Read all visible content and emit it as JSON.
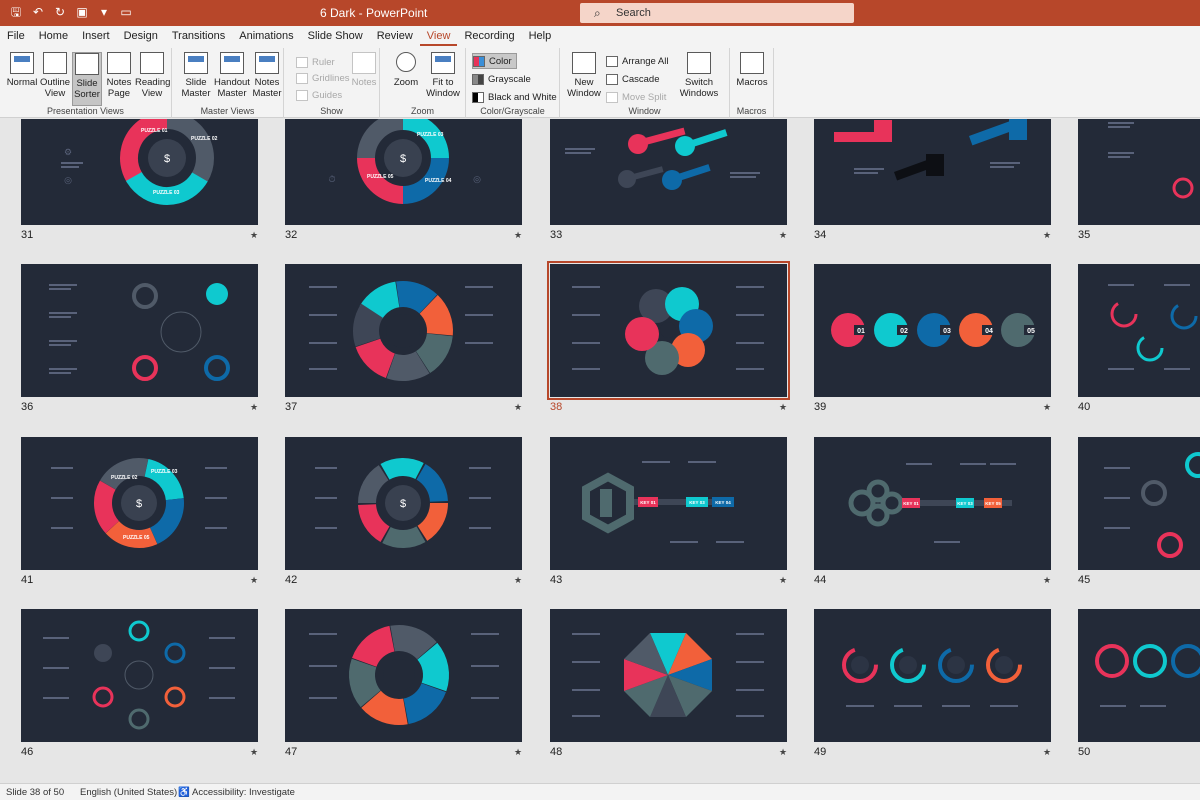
{
  "window": {
    "title": "6 Dark - PowerPoint",
    "search_placeholder": "Search"
  },
  "quick_access": [
    "save-icon",
    "undo-icon",
    "redo-icon",
    "present-icon",
    "more-icon"
  ],
  "tabs": [
    "File",
    "Home",
    "Insert",
    "Design",
    "Transitions",
    "Animations",
    "Slide Show",
    "Review",
    "View",
    "Recording",
    "Help"
  ],
  "active_tab": "View",
  "ribbon": {
    "presentation_views": {
      "label": "Presentation Views",
      "normal": "Normal",
      "outline": "Outline View",
      "sorter": "Slide Sorter",
      "notes_page": "Notes Page",
      "reading": "Reading View"
    },
    "master_views": {
      "label": "Master Views",
      "slide_master": "Slide Master",
      "handout_master": "Handout Master",
      "notes_master": "Notes Master"
    },
    "show": {
      "label": "Show",
      "ruler": "Ruler",
      "gridlines": "Gridlines",
      "guides": "Guides",
      "notes": "Notes"
    },
    "zoom": {
      "label": "Zoom",
      "zoom": "Zoom",
      "fit": "Fit to Window"
    },
    "color": {
      "label": "Color/Grayscale",
      "color": "Color",
      "grayscale": "Grayscale",
      "bw": "Black and White"
    },
    "window": {
      "label": "Window",
      "new_window": "New Window",
      "arrange_all": "Arrange All",
      "cascade": "Cascade",
      "move_split": "Move Split",
      "switch_windows": "Switch Windows"
    },
    "macros": {
      "label": "Macros",
      "macros": "Macros"
    }
  },
  "slides": {
    "numbers": [
      "31",
      "32",
      "33",
      "34",
      "35",
      "36",
      "37",
      "38",
      "39",
      "40",
      "41",
      "42",
      "43",
      "44",
      "45",
      "46",
      "47",
      "48",
      "49",
      "50"
    ],
    "selected": "38",
    "s31": [
      "PUZZLE 01",
      "PUZZLE 02",
      "PUZZLE 03"
    ],
    "s32": [
      "PUZZLE 03",
      "PUZZLE 04",
      "PUZZLE 05"
    ],
    "s39": [
      "01",
      "02",
      "03",
      "04",
      "05"
    ],
    "s43": [
      "KEY 01",
      "KEY 03",
      "KEY 04"
    ],
    "s44": [
      "KEY 01",
      "KEY 03",
      "KEY 05"
    ],
    "s41": [
      "PUZZLE 02",
      "PUZZLE 03",
      "PUZZLE 05"
    ]
  },
  "status": {
    "slide": "Slide 38 of 50",
    "language": "English (United States)",
    "accessibility": "Accessibility: Investigate"
  },
  "colors": {
    "accent": "#b7472a",
    "slide_bg": "#232a38",
    "pink": "#e8335a",
    "cyan": "#0fc9cf",
    "blue": "#0e6aa8",
    "orange": "#f2603a",
    "gray": "#4f6a6e"
  }
}
